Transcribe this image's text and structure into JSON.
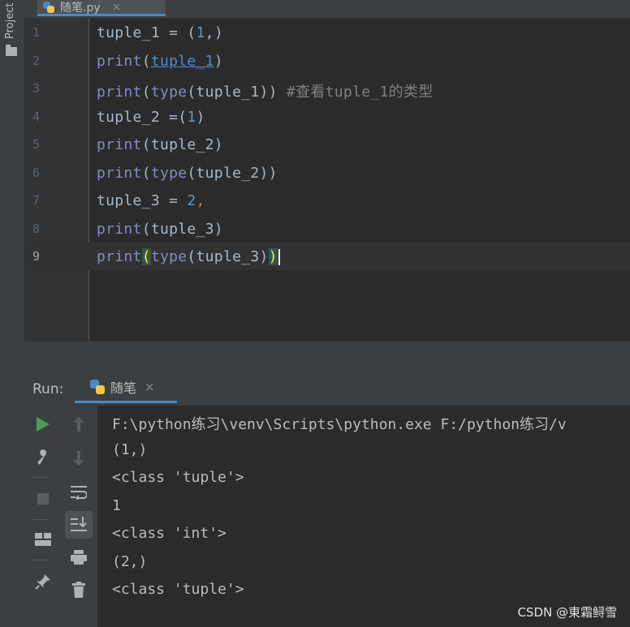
{
  "project_strip": {
    "label": "Project"
  },
  "tab": {
    "filename": "随笔.py",
    "close": "×"
  },
  "editor": {
    "lines": [
      {
        "num": "1",
        "parts": [
          [
            "var",
            "tuple_1"
          ],
          [
            "op",
            " = "
          ],
          [
            "op",
            "("
          ],
          [
            "num",
            "1"
          ],
          [
            "op",
            ","
          ],
          [
            "op",
            ")"
          ]
        ]
      },
      {
        "num": "2",
        "parts": [
          [
            "kw",
            "print"
          ],
          [
            "op",
            "("
          ],
          [
            "ul",
            "tuple_1"
          ],
          [
            "op",
            ")"
          ]
        ]
      },
      {
        "num": "3",
        "parts": [
          [
            "kw",
            "print"
          ],
          [
            "op",
            "("
          ],
          [
            "kw",
            "type"
          ],
          [
            "op",
            "("
          ],
          [
            "var",
            "tuple_1"
          ],
          [
            "op",
            "))"
          ],
          [
            "cm",
            " #查看tuple_1的类型"
          ]
        ]
      },
      {
        "num": "4",
        "parts": [
          [
            "var",
            "tuple_2"
          ],
          [
            "op",
            " ="
          ],
          [
            "op",
            "("
          ],
          [
            "num",
            "1"
          ],
          [
            "op",
            ")"
          ]
        ]
      },
      {
        "num": "5",
        "parts": [
          [
            "kw",
            "print"
          ],
          [
            "op",
            "("
          ],
          [
            "var",
            "tuple_2"
          ],
          [
            "op",
            ")"
          ]
        ]
      },
      {
        "num": "6",
        "parts": [
          [
            "kw",
            "print"
          ],
          [
            "op",
            "("
          ],
          [
            "kw",
            "type"
          ],
          [
            "op",
            "("
          ],
          [
            "var",
            "tuple_2"
          ],
          [
            "op",
            "))"
          ]
        ]
      },
      {
        "num": "7",
        "parts": [
          [
            "var",
            "tuple_3"
          ],
          [
            "op",
            " = "
          ],
          [
            "num",
            "2"
          ],
          [
            "comma",
            ","
          ]
        ]
      },
      {
        "num": "8",
        "parts": [
          [
            "kw",
            "print"
          ],
          [
            "op",
            "("
          ],
          [
            "var",
            "tuple_3"
          ],
          [
            "op",
            ")"
          ]
        ]
      },
      {
        "num": "9",
        "parts": [
          [
            "kw",
            "print"
          ],
          [
            "br",
            "("
          ],
          [
            "kw",
            "type"
          ],
          [
            "op",
            "("
          ],
          [
            "var",
            "tuple_3"
          ],
          [
            "op",
            ")"
          ],
          [
            "br",
            ")"
          ],
          [
            "caret",
            ""
          ]
        ]
      }
    ]
  },
  "run": {
    "label": "Run:",
    "tab_label": "随笔",
    "tab_close": "×",
    "toolbar_icons": [
      "run-icon",
      "wrench-icon",
      "stop-icon",
      "layout-icon",
      "pin-icon",
      "up-arrow-icon",
      "down-arrow-icon",
      "soft-wrap-icon",
      "scroll-to-end-icon",
      "print-icon",
      "trash-icon"
    ],
    "console_lines": [
      "F:\\python练习\\venv\\Scripts\\python.exe F:/python练习/v",
      "(1,)",
      "<class 'tuple'>",
      "1",
      "<class 'int'>",
      "(2,)",
      "<class 'tuple'>"
    ]
  },
  "watermark": "CSDN @東霜鲟雪",
  "colors": {
    "background": "#2b2b2b",
    "keyword": "#8888c6",
    "number": "#6897bb",
    "comment": "#808080",
    "accent": "#4a88c7"
  }
}
